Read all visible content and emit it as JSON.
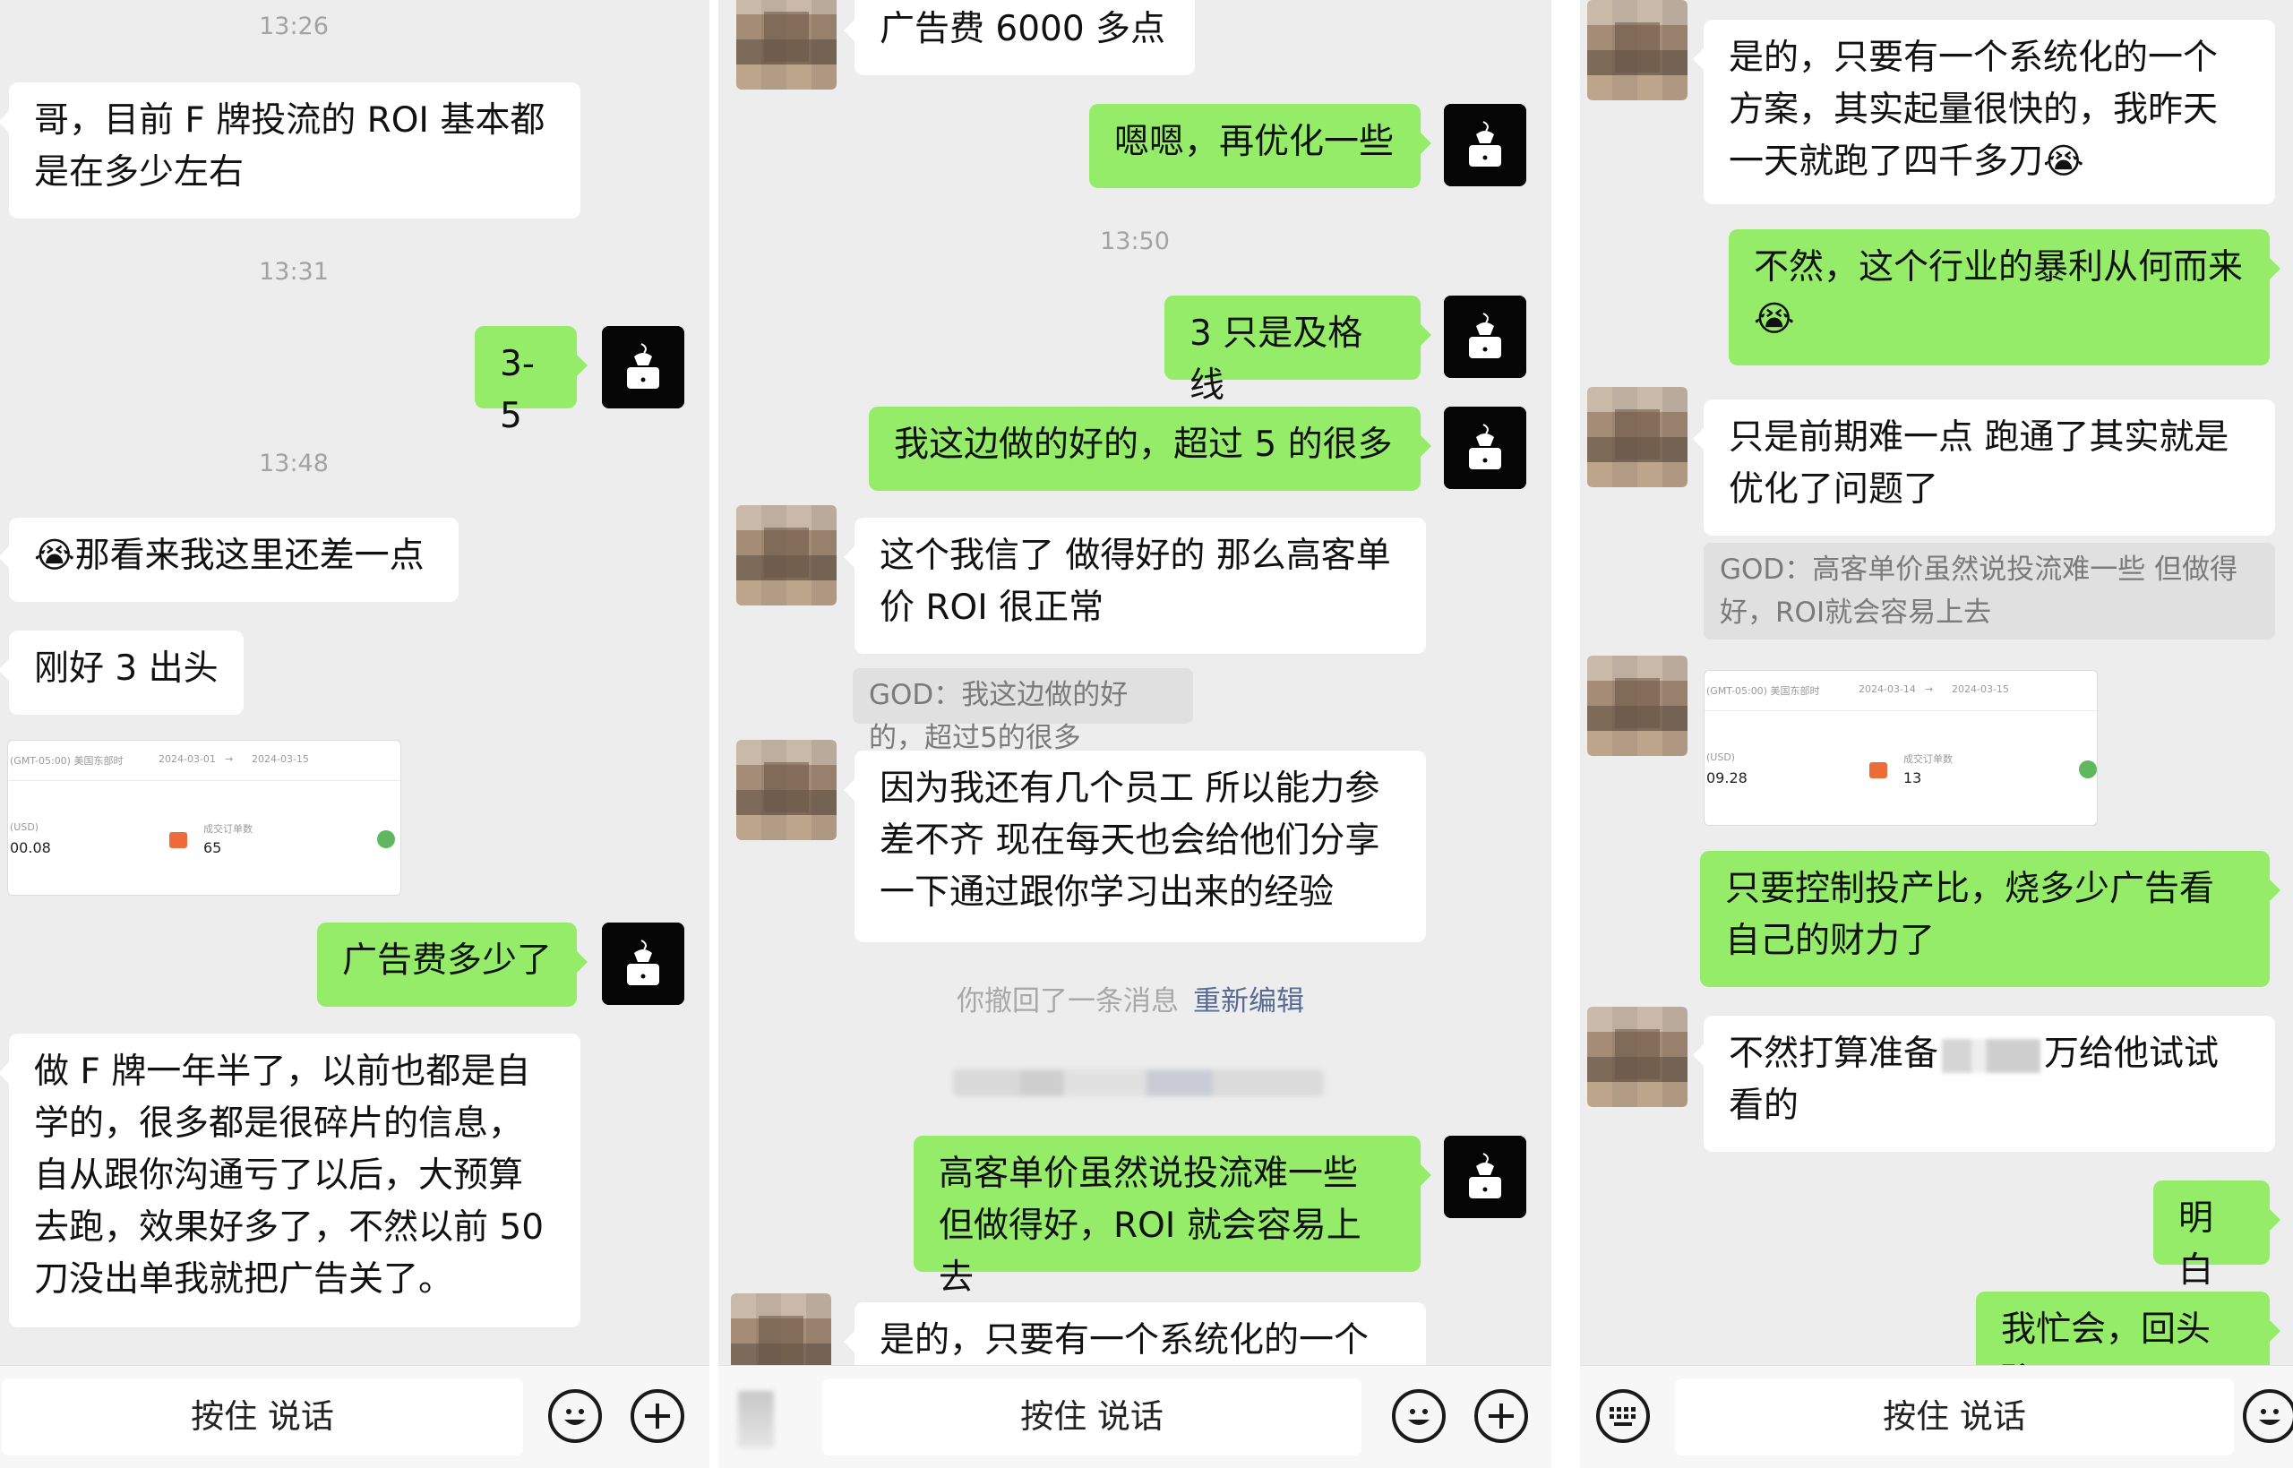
{
  "colors": {
    "self_bubble": "#95ec69",
    "other_bubble": "#ffffff",
    "background": "#ededed",
    "link": "#576b95"
  },
  "panel1": {
    "timestamps": [
      "13:26",
      "13:31",
      "13:48"
    ],
    "messages": [
      {
        "text": "哥，目前 F 牌投流的 ROI 基本都是在多少左右"
      },
      {
        "text": "3-5"
      },
      {
        "text": "😭那看来我这里还差一点"
      },
      {
        "text": "刚好 3 出头"
      },
      {
        "text": "广告费多少了"
      },
      {
        "text": "做 F 牌一年半了，以前也都是自学的，很多都是很碎片的信息，自从跟你沟通亏了以后，大预算去跑，效果好多了，不然以前 50 刀没出单我就把广告关了。"
      }
    ],
    "image": {
      "top_text": "(GMT-05:00) 美国东部时",
      "date_from": "2024-03-01",
      "arrow": "→",
      "date_to": "2024-03-15",
      "left_label": "(USD)",
      "left_value": "00.08",
      "mid_label": "成交订单数",
      "mid_value": "65"
    },
    "bottom_label": "按住 说话"
  },
  "panel2": {
    "timestamps": [
      "13:50"
    ],
    "messages": [
      {
        "text": "广告费 6000 多点"
      },
      {
        "text": "嗯嗯，再优化一些"
      },
      {
        "text": "3 只是及格线"
      },
      {
        "text": "我这边做的好的，超过 5 的很多"
      },
      {
        "text": "这个我信了  做得好的 那么高客单价 ROI 很正常"
      },
      {
        "text": "因为我还有几个员工 所以能力参差不齐  现在每天也会给他们分享一下通过跟你学习出来的经验"
      },
      {
        "text": "高客单价虽然说投流难一些 但做得好，ROI 就会容易上去"
      },
      {
        "text": "是的，只要有一个系统化的一个方"
      }
    ],
    "quote": "GOD：我这边做的好的，超过5的很多",
    "recall_text": "你撤回了一条消息",
    "recall_link": "重新编辑",
    "bottom_label": "按住 说话"
  },
  "panel3": {
    "messages": [
      {
        "text": "是的，只要有一个系统化的一个方案，其实起量很快的，我昨天一天就跑了四千多刀😭"
      },
      {
        "text": "不然，这个行业的暴利从何而来😭"
      },
      {
        "text": "只是前期难一点 跑通了其实就是优化了问题了"
      },
      {
        "text": "只要控制投产比，烧多少广告看自己的财力了"
      },
      {
        "text_a": "不然打算准备",
        "text_b": "万给他试试看的"
      },
      {
        "text": "明白"
      },
      {
        "text": "我忙会，回头聊"
      }
    ],
    "quote": "GOD：高客单价虽然说投流难一些 但做得好，ROI就会容易上去",
    "image": {
      "top_text": "(GMT-05:00) 美国东部时",
      "date_from": "2024-03-14",
      "arrow": "→",
      "date_to": "2024-03-15",
      "left_label": "(USD)",
      "left_value": "09.28",
      "mid_label": "成交订单数",
      "mid_value": "13"
    },
    "bottom_label": "按住 说话"
  }
}
